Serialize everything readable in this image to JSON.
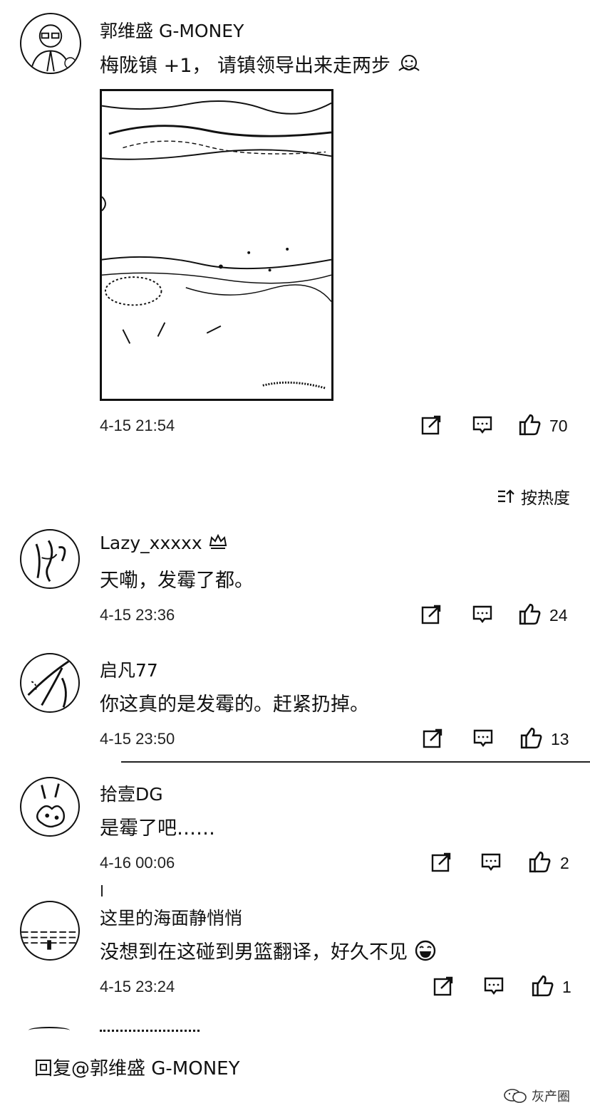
{
  "post": {
    "author": "郭维盛 G-MONEY",
    "text": "梅陇镇 +1， 请镇领导出来走两步",
    "timestamp": "4-15 21:54",
    "likes": "70",
    "emoji_icon": "facepalm-emoji"
  },
  "sort": {
    "label": "按热度",
    "icon": "sort-icon"
  },
  "comments": [
    {
      "author": "Lazy_xxxxx",
      "text": "天嘞，发霉了都。",
      "timestamp": "4-15 23:36",
      "likes": "24"
    },
    {
      "author": "启凡77",
      "text": "你这真的是发霉的。赶紧扔掉。",
      "timestamp": "4-15 23:50",
      "likes": "13"
    },
    {
      "author": "拾壹DG",
      "text": "是霉了吧……",
      "timestamp": "4-16 00:06",
      "likes": "2"
    },
    {
      "author": "这里的海面静悄悄",
      "text": "没想到在这碰到男篮翻译，好久不见",
      "timestamp": "4-15 23:24",
      "likes": "1"
    }
  ],
  "reply_bar": {
    "placeholder": "回复@郭维盛 G-MONEY"
  },
  "watermark": {
    "label": "灰产圈"
  },
  "colors": {
    "text": "#111111",
    "background": "#ffffff"
  }
}
